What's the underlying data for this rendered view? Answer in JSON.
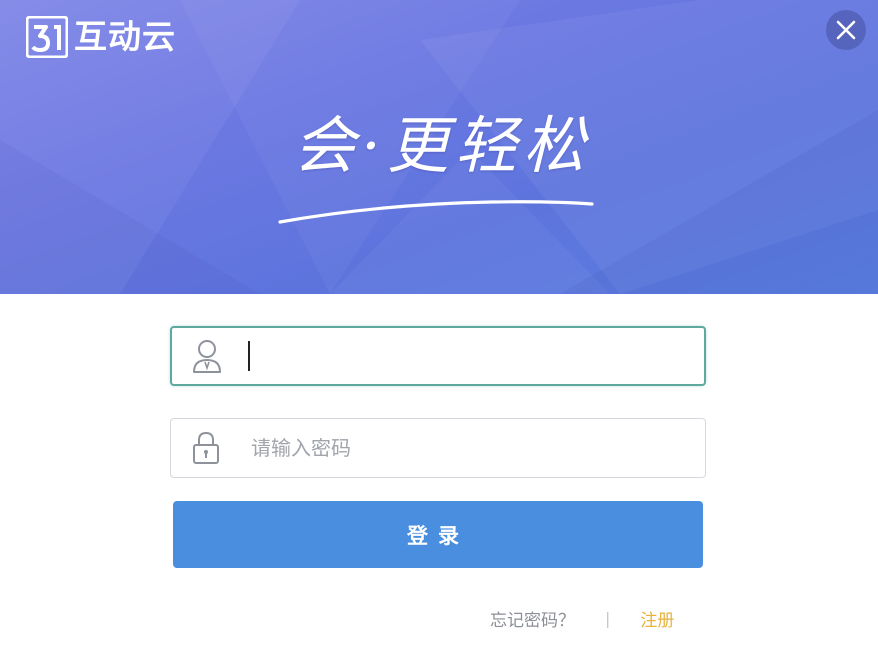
{
  "app": {
    "logo_mark": "31",
    "logo_text": "互动云"
  },
  "banner": {
    "slogan": "会·更轻松"
  },
  "close": {
    "icon": "close-icon"
  },
  "form": {
    "username": {
      "value": "",
      "placeholder": "",
      "icon": "user-icon"
    },
    "password": {
      "value": "",
      "placeholder": "请输入密码",
      "icon": "lock-icon"
    },
    "login_label": "登录"
  },
  "footer": {
    "forgot_label": "忘记密码？",
    "divider": "|",
    "register_label": "注册"
  },
  "colors": {
    "banner_start": "#7f86e7",
    "banner_end": "#5a7fe0",
    "button": "#4a8fdf",
    "active_border": "#5fa8a0",
    "register": "#e6b23c"
  }
}
